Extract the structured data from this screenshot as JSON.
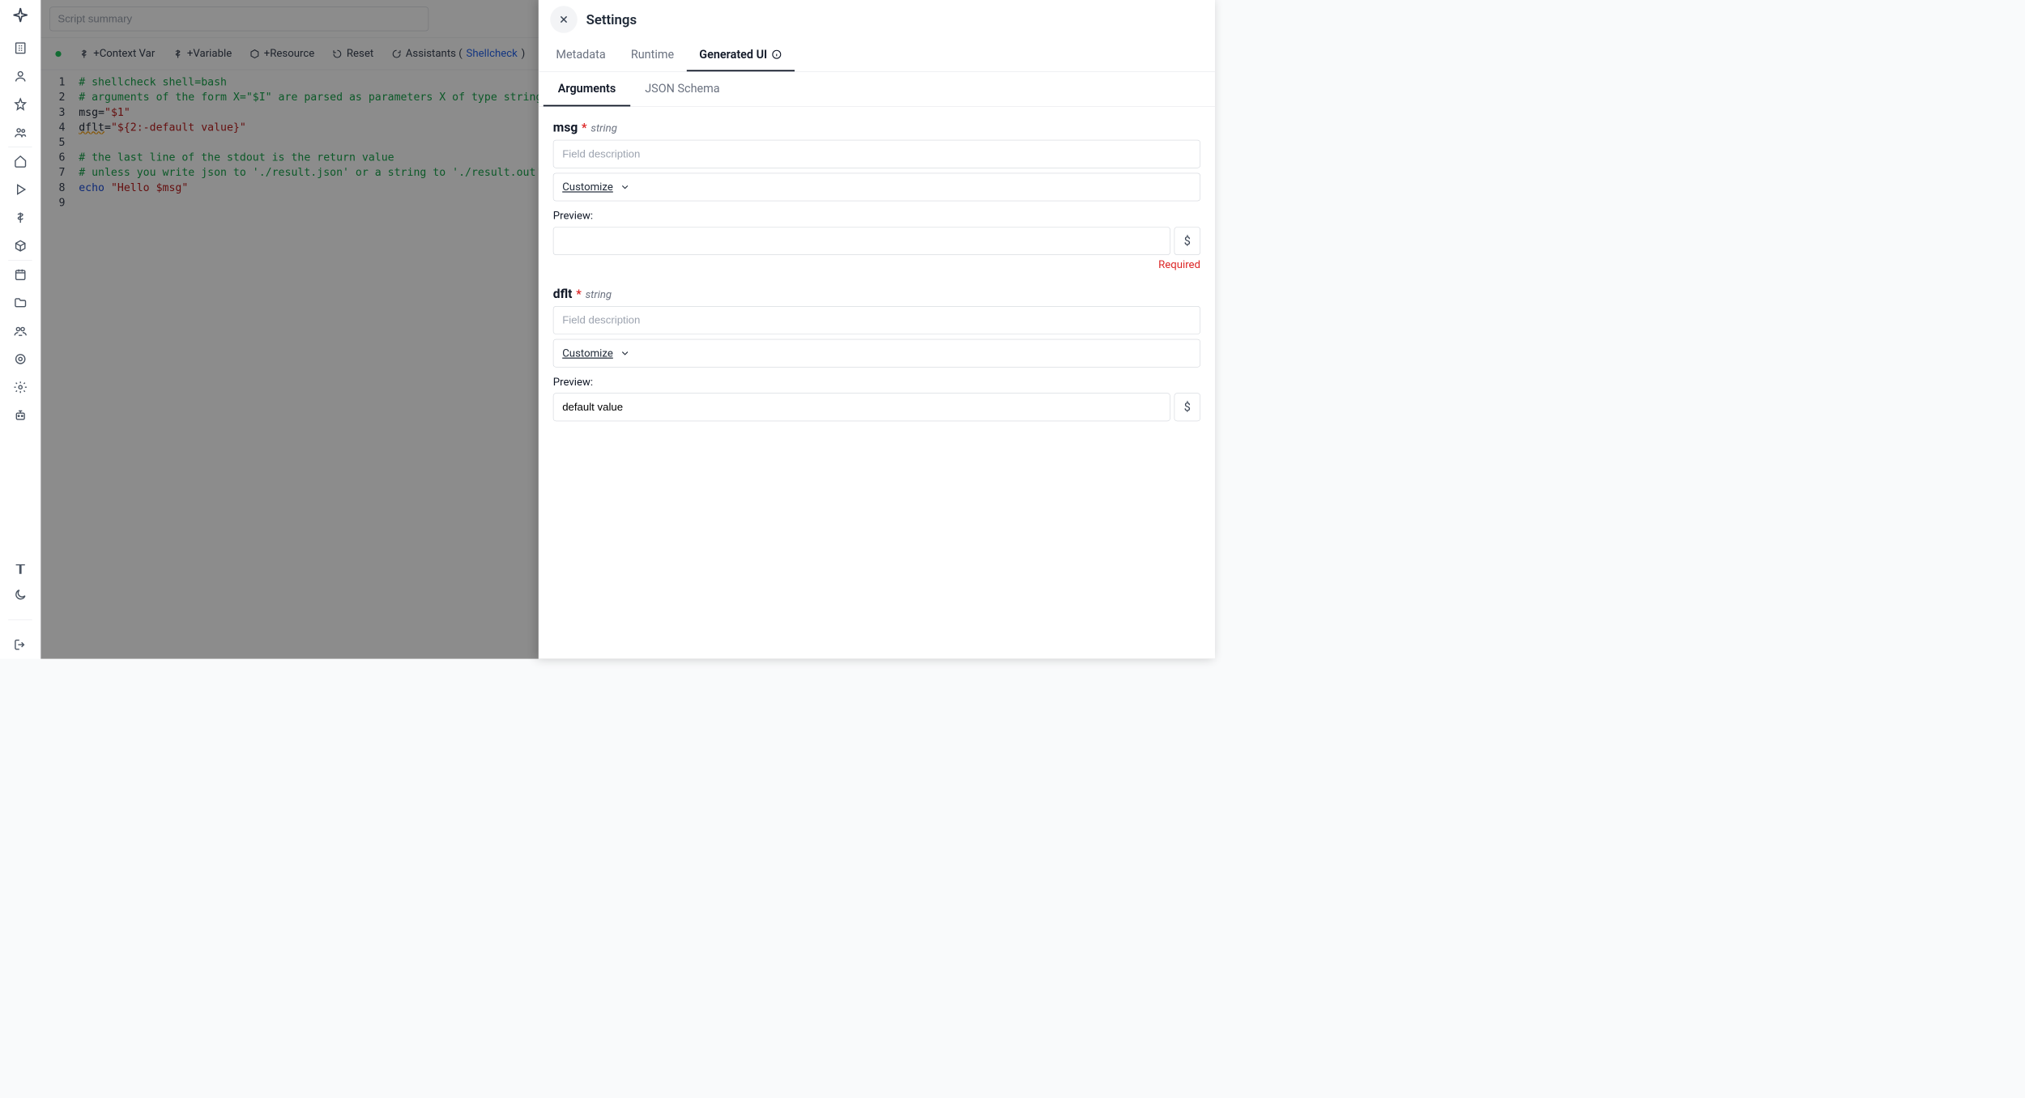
{
  "topbar": {
    "summary_placeholder": "Script summary"
  },
  "toolbar": {
    "context_var": "+Context Var",
    "variable": "+Variable",
    "resource": "+Resource",
    "reset": "Reset",
    "assistants_prefix": "Assistants (",
    "assistants_link": "Shellcheck",
    "assistants_suffix": ")"
  },
  "editor": {
    "line_numbers": [
      "1",
      "2",
      "3",
      "4",
      "5",
      "6",
      "7",
      "8",
      "9"
    ],
    "lines": [
      {
        "type": "comment",
        "text": "# shellcheck shell=bash"
      },
      {
        "type": "comment",
        "text": "# arguments of the form X=\"$I\" are parsed as parameters X of type string"
      },
      {
        "type": "assign",
        "lhs": "msg=",
        "rhs": "\"$1\""
      },
      {
        "type": "assign",
        "lhs": "dflt=",
        "rhs": "\"${2:-default value}\"",
        "warn": true
      },
      {
        "type": "blank",
        "text": ""
      },
      {
        "type": "comment",
        "text": "# the last line of the stdout is the return value"
      },
      {
        "type": "comment",
        "text": "# unless you write json to './result.json' or a string to './result.out'"
      },
      {
        "type": "echo",
        "kw": "echo",
        "rhs": " \"Hello $msg\""
      },
      {
        "type": "blank",
        "text": ""
      }
    ]
  },
  "panel": {
    "title": "Settings",
    "tabs": {
      "metadata": "Metadata",
      "runtime": "Runtime",
      "generated_ui": "Generated UI"
    },
    "subtabs": {
      "arguments": "Arguments",
      "json_schema": "JSON Schema"
    },
    "desc_placeholder": "Field description",
    "customize_label": "Customize",
    "preview_label": "Preview:",
    "required_label": "Required",
    "dollar_glyph": "$",
    "args": [
      {
        "name": "msg",
        "type": "string",
        "preview": "",
        "required_shown": true
      },
      {
        "name": "dflt",
        "type": "string",
        "preview": "default value",
        "required_shown": false
      }
    ]
  }
}
